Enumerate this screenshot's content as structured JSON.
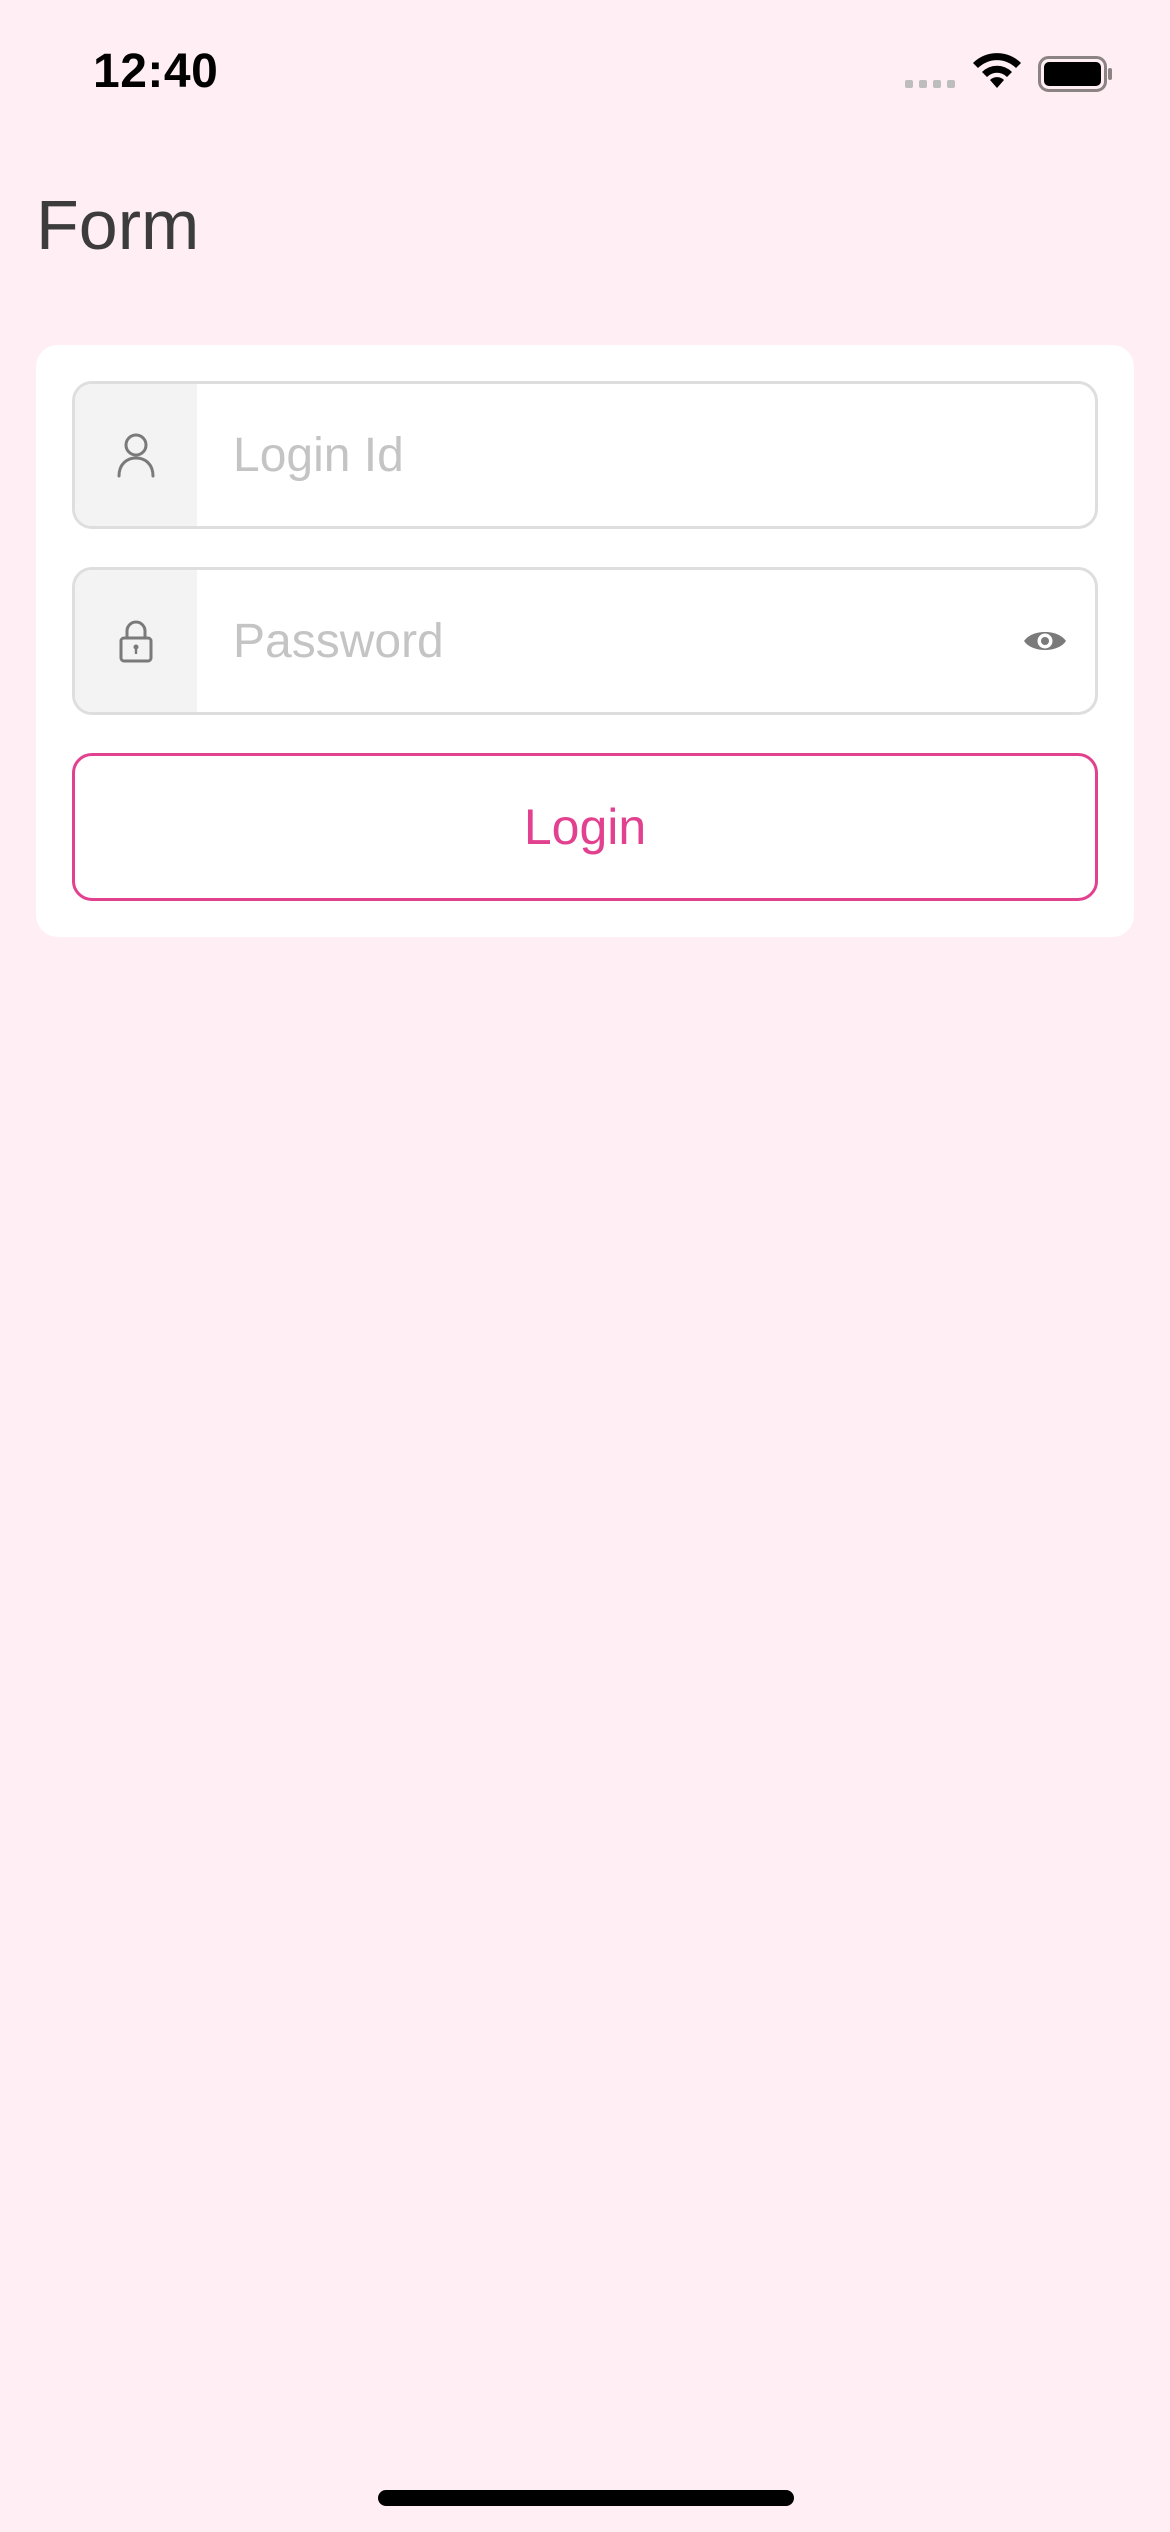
{
  "status_bar": {
    "time": "12:40",
    "wifi_icon": "wifi-icon",
    "battery_icon": "battery-icon"
  },
  "page": {
    "title": "Form"
  },
  "form": {
    "login_field": {
      "icon": "user-icon",
      "placeholder": "Login Id",
      "value": ""
    },
    "password_field": {
      "icon": "lock-icon",
      "placeholder": "Password",
      "value": "",
      "toggle_icon": "eye-icon"
    },
    "login_button": {
      "label": "Login"
    }
  },
  "colors": {
    "background": "#ffeef3",
    "accent": "#e2418f",
    "card": "#ffffff",
    "field_border": "#dedede",
    "icon_gray": "#7a7a7a"
  }
}
